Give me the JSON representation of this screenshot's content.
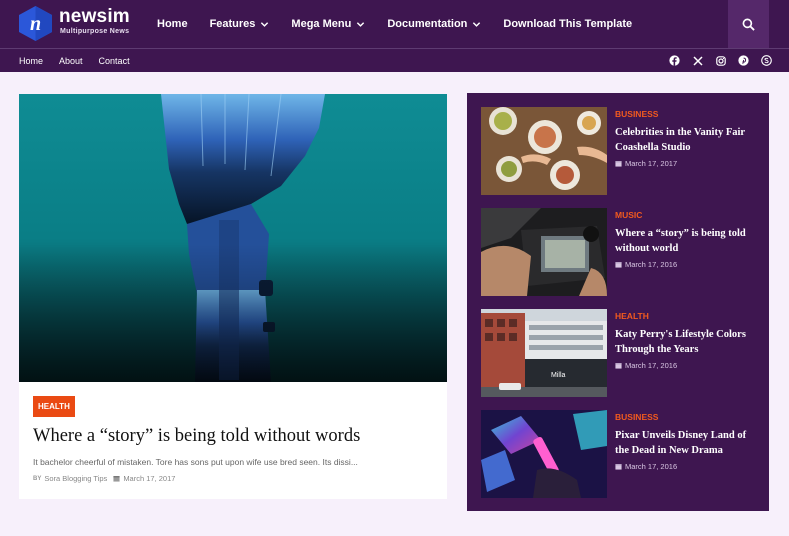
{
  "header": {
    "logo_title": "newsim",
    "logo_subtitle": "Multipurpose News",
    "logo_letter": "n",
    "nav": [
      {
        "label": "Home",
        "dropdown": false
      },
      {
        "label": "Features",
        "dropdown": true
      },
      {
        "label": "Mega Menu",
        "dropdown": true
      },
      {
        "label": "Documentation",
        "dropdown": true
      },
      {
        "label": "Download This Template",
        "dropdown": false
      }
    ],
    "search_icon": "search-icon"
  },
  "subnav": {
    "links": [
      "Home",
      "About",
      "Contact"
    ],
    "socials": [
      "facebook-icon",
      "x-icon",
      "instagram-icon",
      "pinterest-icon",
      "skype-icon"
    ]
  },
  "featured": {
    "category": "HEALTH",
    "title": "Where a “story” is being told without words",
    "excerpt": "It bachelor cheerful of mistaken. Tore has sons put upon wife use bred seen. Its dissi...",
    "by_label": "BY",
    "author": "Sora Blogging Tips",
    "date": "March 17, 2017"
  },
  "sidebar": {
    "posts": [
      {
        "category": "BUSINESS",
        "title": "Celebrities in the Vanity Fair Coashella Studio",
        "date": "March 17, 2017"
      },
      {
        "category": "MUSIC",
        "title": "Where a “story” is being told without world",
        "date": "March 17, 2016"
      },
      {
        "category": "HEALTH",
        "title": "Katy Perry's Lifestyle Colors Through the Years",
        "date": "March 17, 2016"
      },
      {
        "category": "BUSINESS",
        "title": "Pixar Unveils Disney Land of the Dead in New Drama",
        "date": "March 17, 2016"
      }
    ]
  },
  "colors": {
    "brand_purple": "#3e1650",
    "accent_orange": "#ea4a13",
    "page_bg": "#f7f0fb",
    "logo_blue": "#2b57d9"
  }
}
